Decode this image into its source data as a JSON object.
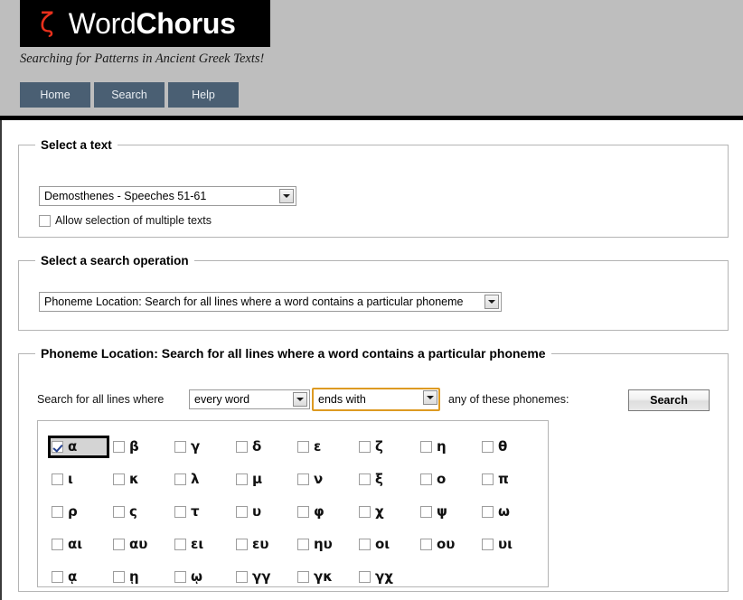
{
  "header": {
    "logo_symbol": "ζ",
    "logo_text_light": "Word",
    "logo_text_bold": "Chorus",
    "tagline": "Searching for Patterns in Ancient Greek Texts!",
    "nav": [
      {
        "label": "Home"
      },
      {
        "label": "Search"
      },
      {
        "label": "Help"
      }
    ],
    "colors": {
      "header_background": "#bebebe",
      "logo_background": "#000000",
      "logo_symbol_color": "#e8301c",
      "nav_background": "#4a5f73",
      "nav_text": "#e9eef3"
    }
  },
  "select_text": {
    "legend": "Select a text",
    "text_select_value": "Demosthenes - Speeches 51-61",
    "allow_multiple_label": "Allow selection of multiple texts",
    "allow_multiple_checked": false
  },
  "select_operation": {
    "legend": "Select a search operation",
    "operation_value": "Phoneme Location: Search for all lines where a word contains a particular phoneme"
  },
  "phoneme_location": {
    "legend": "Phoneme Location: Search for all lines where a word contains a particular phoneme",
    "label_prefix": "Search for all lines where",
    "word_scope_value": "every word",
    "position_value": "ends with",
    "label_suffix": "any of these phonemes:",
    "search_button": "Search",
    "focus_color": "#dd9a22",
    "grid": [
      [
        {
          "glyph": "α",
          "checked": true,
          "selected": true
        },
        {
          "glyph": "β",
          "checked": false,
          "selected": false
        },
        {
          "glyph": "γ",
          "checked": false,
          "selected": false
        },
        {
          "glyph": "δ",
          "checked": false,
          "selected": false
        },
        {
          "glyph": "ε",
          "checked": false,
          "selected": false
        },
        {
          "glyph": "ζ",
          "checked": false,
          "selected": false
        },
        {
          "glyph": "η",
          "checked": false,
          "selected": false
        },
        {
          "glyph": "θ",
          "checked": false,
          "selected": false
        }
      ],
      [
        {
          "glyph": "ι",
          "checked": false,
          "selected": false
        },
        {
          "glyph": "κ",
          "checked": false,
          "selected": false
        },
        {
          "glyph": "λ",
          "checked": false,
          "selected": false
        },
        {
          "glyph": "μ",
          "checked": false,
          "selected": false
        },
        {
          "glyph": "ν",
          "checked": false,
          "selected": false
        },
        {
          "glyph": "ξ",
          "checked": false,
          "selected": false
        },
        {
          "glyph": "ο",
          "checked": false,
          "selected": false
        },
        {
          "glyph": "π",
          "checked": false,
          "selected": false
        }
      ],
      [
        {
          "glyph": "ρ",
          "checked": false,
          "selected": false
        },
        {
          "glyph": "ς",
          "checked": false,
          "selected": false
        },
        {
          "glyph": "τ",
          "checked": false,
          "selected": false
        },
        {
          "glyph": "υ",
          "checked": false,
          "selected": false
        },
        {
          "glyph": "φ",
          "checked": false,
          "selected": false
        },
        {
          "glyph": "χ",
          "checked": false,
          "selected": false
        },
        {
          "glyph": "ψ",
          "checked": false,
          "selected": false
        },
        {
          "glyph": "ω",
          "checked": false,
          "selected": false
        }
      ],
      [
        {
          "glyph": "αι",
          "checked": false,
          "selected": false
        },
        {
          "glyph": "αυ",
          "checked": false,
          "selected": false
        },
        {
          "glyph": "ει",
          "checked": false,
          "selected": false
        },
        {
          "glyph": "ευ",
          "checked": false,
          "selected": false
        },
        {
          "glyph": "ηυ",
          "checked": false,
          "selected": false
        },
        {
          "glyph": "οι",
          "checked": false,
          "selected": false
        },
        {
          "glyph": "ου",
          "checked": false,
          "selected": false
        },
        {
          "glyph": "υι",
          "checked": false,
          "selected": false
        }
      ],
      [
        {
          "glyph": "ᾳ",
          "checked": false,
          "selected": false
        },
        {
          "glyph": "ῃ",
          "checked": false,
          "selected": false
        },
        {
          "glyph": "ῳ",
          "checked": false,
          "selected": false
        },
        {
          "glyph": "γγ",
          "checked": false,
          "selected": false
        },
        {
          "glyph": "γκ",
          "checked": false,
          "selected": false
        },
        {
          "glyph": "γχ",
          "checked": false,
          "selected": false
        }
      ]
    ]
  }
}
